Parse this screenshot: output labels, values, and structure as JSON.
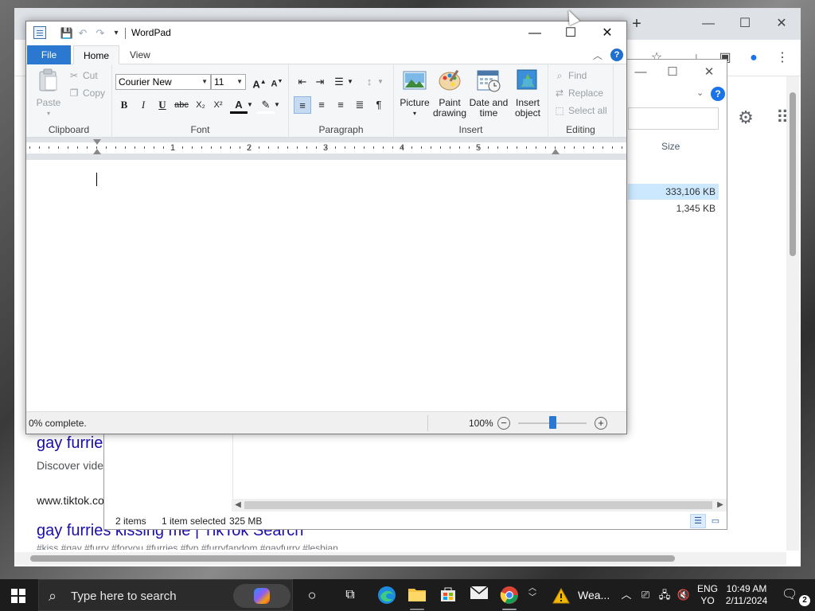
{
  "chrome": {
    "new_tab": "+",
    "minimize": "—",
    "maximize": "☐",
    "close": "✕",
    "results": [
      {
        "title": "gay furrie",
        "snippet": "Discover vide",
        "url": "www.tiktok.co"
      },
      {
        "title": "gay furries kissing me | TikTok Search",
        "faded": "#kiss  #gay  #furry  #foryou  #furries  #fyp  #furryfandom  #gayfurry  #lesbian"
      }
    ]
  },
  "explorer": {
    "minimize": "—",
    "maximize": "☐",
    "close": "✕",
    "help": "?",
    "column_size": "Size",
    "rows": [
      {
        "size": "333,106 KB",
        "selected": true
      },
      {
        "size": "1,345 KB",
        "selected": false
      }
    ],
    "status": {
      "items": "2 items",
      "selected": "1 item selected",
      "size": "325 MB"
    }
  },
  "wordpad": {
    "title": "WordPad",
    "minimize": "—",
    "maximize": "☐",
    "close": "✕",
    "tabs": {
      "file": "File",
      "home": "Home",
      "view": "View"
    },
    "help": "?",
    "clipboard": {
      "label": "Clipboard",
      "paste": "Paste",
      "cut": "Cut",
      "copy": "Copy"
    },
    "font": {
      "label": "Font",
      "family": "Courier New",
      "size": "11",
      "bold": "B",
      "italic": "I",
      "underline": "U",
      "strike": "abc",
      "subscript": "X₂",
      "superscript": "X²",
      "color": "A"
    },
    "paragraph": {
      "label": "Paragraph"
    },
    "insert": {
      "label": "Insert",
      "picture": "Picture",
      "paint_line1": "Paint",
      "paint_line2": "drawing",
      "datetime_line1": "Date and",
      "datetime_line2": "time",
      "object_line1": "Insert",
      "object_line2": "object"
    },
    "editing": {
      "label": "Editing",
      "find": "Find",
      "replace": "Replace",
      "select_all": "Select all"
    },
    "ruler": [
      "1",
      "2",
      "3",
      "4",
      "5"
    ],
    "status_text": "0% complete.",
    "zoom": "100%",
    "zoom_level": 0.5
  },
  "taskbar": {
    "search_placeholder": "Type here to search",
    "weather": "Wea...",
    "lang_line1": "ENG",
    "lang_line2": "YO",
    "time": "10:49 AM",
    "date": "2/11/2024",
    "notification_count": "2"
  }
}
